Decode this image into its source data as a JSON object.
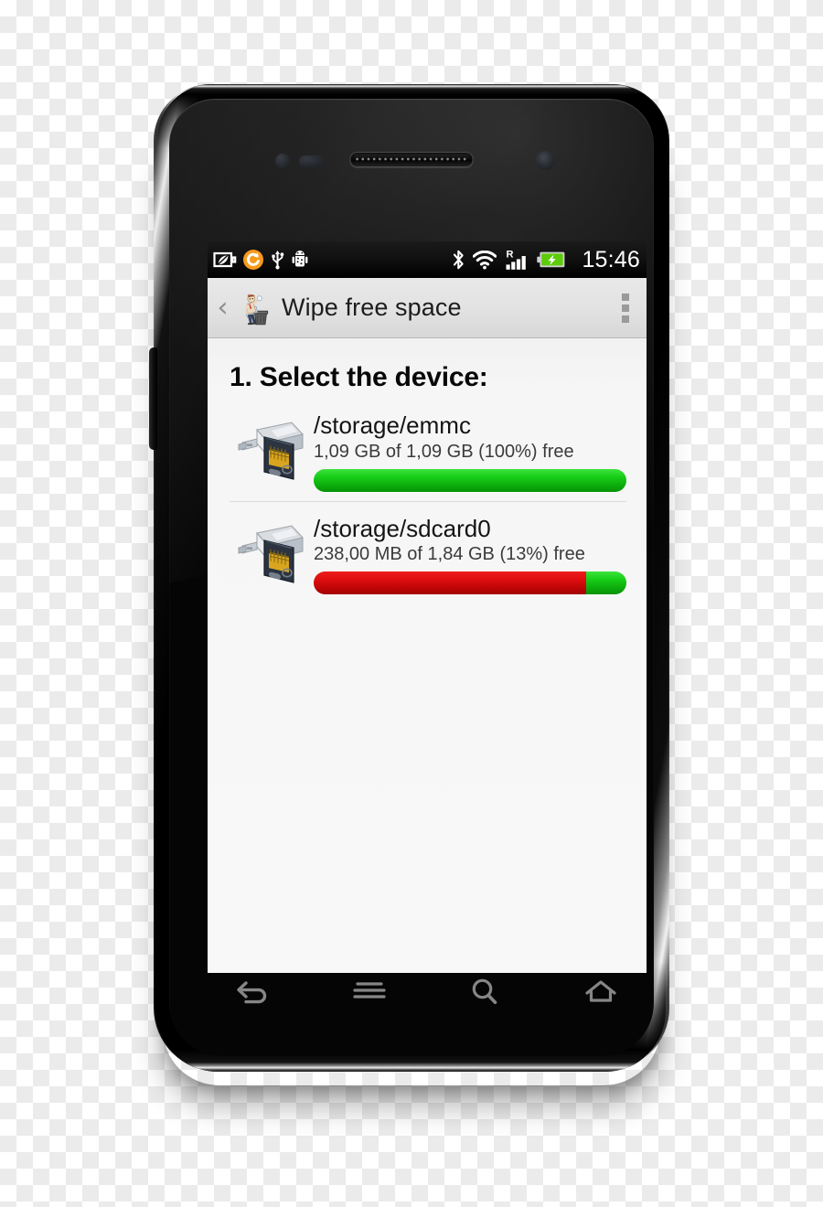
{
  "device_frame": {
    "name": "android-smartphone-mockup",
    "hardware": {
      "earpiece": "earpiece-speaker",
      "front_camera": "front-camera",
      "proximity_sensor": "proximity-sensor",
      "light_sensor": "ambient-light-sensor",
      "volume_rocker": "volume-rocker"
    }
  },
  "statusbar": {
    "clock": "15:46",
    "left_icons": [
      {
        "name": "battery-saver-leaf-icon",
        "label": "battery saver"
      },
      {
        "name": "sync-orange-icon",
        "label": "sync"
      },
      {
        "name": "usb-icon",
        "label": "USB connected"
      },
      {
        "name": "android-debug-icon",
        "label": "USB debugging"
      }
    ],
    "right_icons": [
      {
        "name": "bluetooth-icon",
        "label": "Bluetooth"
      },
      {
        "name": "wifi-icon",
        "label": "Wi-Fi"
      },
      {
        "name": "cell-signal-roaming-icon",
        "label": "R",
        "roaming_letter": "R"
      },
      {
        "name": "battery-charging-icon",
        "label": "battery charging"
      }
    ],
    "colors": {
      "background": "#000000",
      "foreground": "#ffffff",
      "battery": "#5ccc0a",
      "sync": "#f79b1d"
    }
  },
  "actionbar": {
    "back_glyph": "‹",
    "title": "Wipe free space",
    "app_icon": "wipe-free-space-app-icon",
    "overflow_label": "More options",
    "background": "#e3e3e3"
  },
  "content": {
    "step_title": "1. Select the device:",
    "devices": [
      {
        "path": "/storage/emmc",
        "stats": "1,09 GB of 1,09 GB (100%) free",
        "free_text": "1,09 GB",
        "total_text": "1,09 GB",
        "free_percent": 100,
        "used_percent": 0,
        "icon": "usb-sdcard-storage-icon"
      },
      {
        "path": "/storage/sdcard0",
        "stats": "238,00 MB of 1,84 GB (13%) free",
        "free_text": "238,00 MB",
        "total_text": "1,84 GB",
        "free_percent": 13,
        "used_percent": 87,
        "icon": "usb-sdcard-storage-icon"
      }
    ],
    "colors": {
      "background": "#f6f6f6",
      "bar_free": "#17cc17",
      "bar_used": "#dd0d0d"
    }
  },
  "navbar": {
    "keys": [
      {
        "name": "nav-back-key",
        "label": "Back"
      },
      {
        "name": "nav-menu-key",
        "label": "Menu"
      },
      {
        "name": "nav-search-key",
        "label": "Search"
      },
      {
        "name": "nav-home-key",
        "label": "Home"
      }
    ]
  }
}
